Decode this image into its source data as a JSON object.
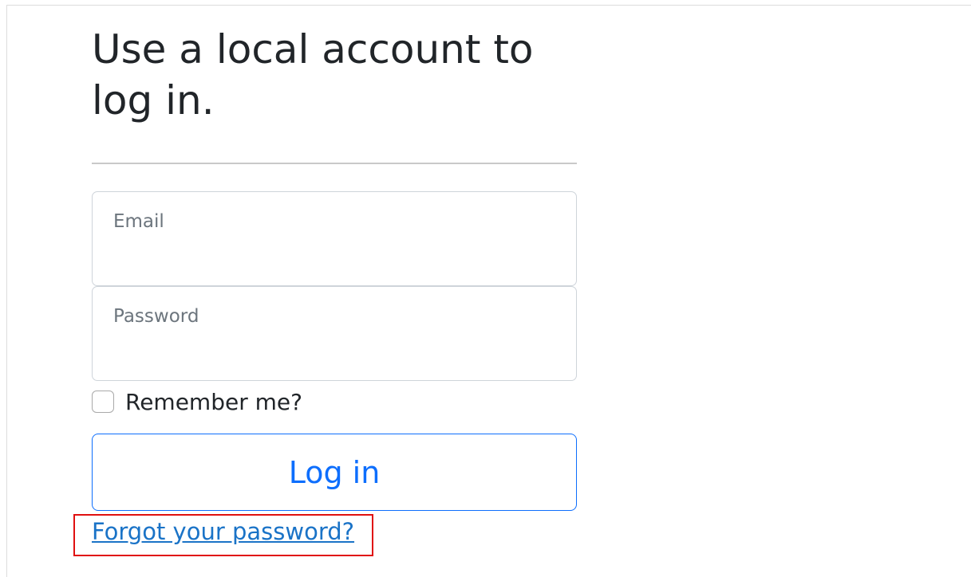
{
  "login": {
    "heading": "Use a local account to log in.",
    "email_label": "Email",
    "password_label": "Password",
    "remember_label": "Remember me?",
    "remember_checked": false,
    "login_button": "Log in",
    "forgot_link": "Forgot your password?"
  },
  "colors": {
    "accent": "#0d6efd",
    "link": "#1a73c7",
    "highlight_box": "#e01010",
    "text": "#212529",
    "muted": "#6c757d"
  }
}
